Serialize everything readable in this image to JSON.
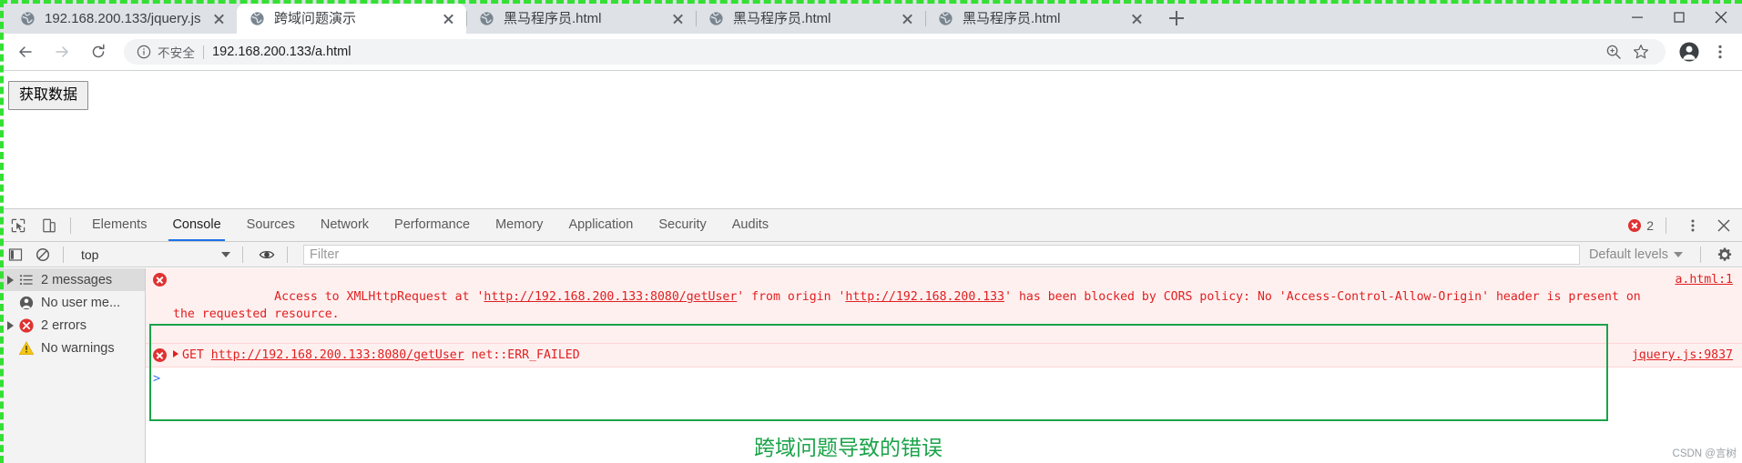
{
  "browser": {
    "tabs": [
      {
        "title": "192.168.200.133/jquery.js",
        "active": false,
        "favicon": "globe-icon"
      },
      {
        "title": "跨域问题演示",
        "active": true,
        "favicon": "globe-icon"
      },
      {
        "title": "黑马程序员.html",
        "active": false,
        "favicon": "globe-icon"
      },
      {
        "title": "黑马程序员.html",
        "active": false,
        "favicon": "globe-icon"
      },
      {
        "title": "黑马程序员.html",
        "active": false,
        "favicon": "globe-icon"
      }
    ],
    "new_tab_label": "+",
    "window_controls": [
      "minimize-icon",
      "maximize-icon",
      "close-icon"
    ],
    "toolbar": {
      "back": "back-arrow-icon",
      "forward": "forward-arrow-icon",
      "reload": "reload-icon",
      "security_label": "不安全",
      "url": "192.168.200.133/a.html",
      "info_icon": "info-circle-icon",
      "zoom_icon": "zoom-in-icon",
      "bookmark_icon": "star-icon",
      "profile_icon": "account-avatar-icon",
      "menu_icon": "three-dot-menu-icon"
    }
  },
  "page": {
    "button_label": "获取数据"
  },
  "devtools": {
    "inspect_icon": "inspect-element-icon",
    "device_icon": "device-toolbar-icon",
    "tabs": [
      {
        "label": "Elements",
        "selected": false
      },
      {
        "label": "Console",
        "selected": true
      },
      {
        "label": "Sources",
        "selected": false
      },
      {
        "label": "Network",
        "selected": false
      },
      {
        "label": "Performance",
        "selected": false
      },
      {
        "label": "Memory",
        "selected": false
      },
      {
        "label": "Application",
        "selected": false
      },
      {
        "label": "Security",
        "selected": false
      },
      {
        "label": "Audits",
        "selected": false
      }
    ],
    "error_count": "2",
    "more_icon": "three-dot-menu-icon",
    "close_icon": "close-icon",
    "filterbar": {
      "sidebar_toggle_icon": "console-sidebar-toggle-icon",
      "clear_icon": "clear-console-icon",
      "context": "top",
      "eye_icon": "live-expression-icon",
      "filter_placeholder": "Filter",
      "levels_label": "Default levels",
      "settings_icon": "gear-icon"
    },
    "sidebar": [
      {
        "label": "2 messages",
        "icon": "message-list-icon",
        "expandable": true,
        "selected": true
      },
      {
        "label": "No user me...",
        "icon": "user-message-icon",
        "expandable": false,
        "selected": false
      },
      {
        "label": "2 errors",
        "icon": "error-icon",
        "expandable": true,
        "selected": false
      },
      {
        "label": "No warnings",
        "icon": "warning-icon",
        "expandable": false,
        "selected": false
      }
    ],
    "messages": [
      {
        "icon": "error-icon",
        "source": "a.html:1",
        "parts": [
          {
            "t": "Access to XMLHttpRequest at '",
            "link": false
          },
          {
            "t": "http://192.168.200.133:8080/getUser",
            "link": true
          },
          {
            "t": "' from origin '",
            "link": false
          },
          {
            "t": "http://192.168.200.133",
            "link": true
          },
          {
            "t": "' has been blocked by CORS policy: No 'Access-Control-Allow-Origin' header is present on the requested resource.",
            "link": false
          }
        ]
      },
      {
        "icon": "error-icon",
        "source": "jquery.js:9837",
        "disclosure": true,
        "parts": [
          {
            "t": "GET ",
            "link": false
          },
          {
            "t": "http://192.168.200.133:8080/getUser",
            "link": true
          },
          {
            "t": " net::ERR_FAILED",
            "link": false
          }
        ]
      }
    ],
    "prompt_caret": ">"
  },
  "annotation": {
    "caption": "跨域问题导致的错误",
    "color": "#1aa349"
  },
  "watermark": "CSDN @言树"
}
